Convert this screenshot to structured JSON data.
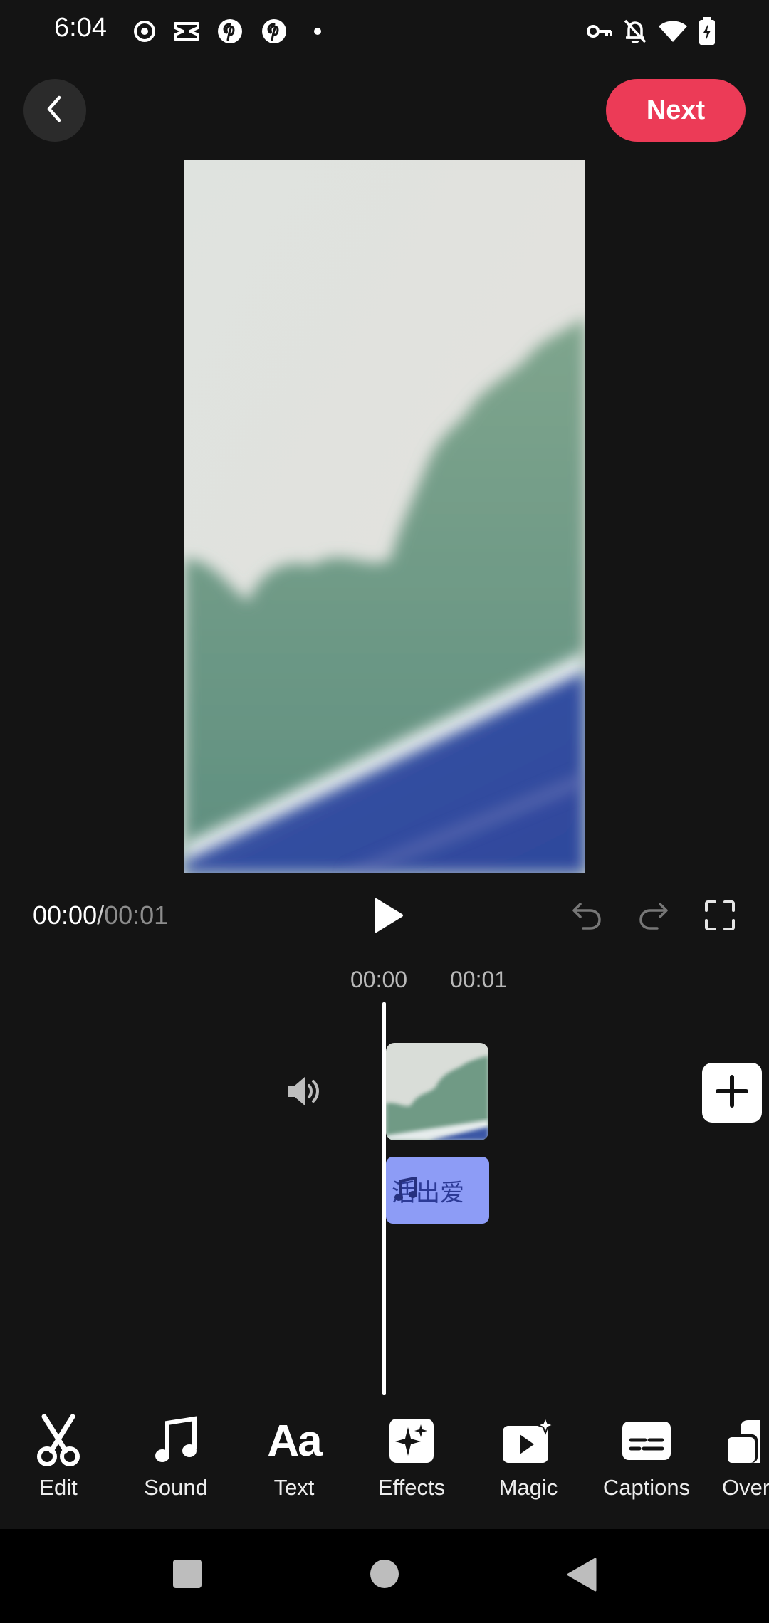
{
  "status_bar": {
    "time": "6:04",
    "left_icons": [
      "target-icon",
      "capcut-icon",
      "pinterest-icon",
      "pinterest-icon",
      "dot-icon"
    ],
    "right_icons": [
      "vpn-key-icon",
      "notifications-off-icon",
      "wifi-icon",
      "battery-charging-icon"
    ]
  },
  "header": {
    "next_label": "Next"
  },
  "playback": {
    "current_time": "00:00",
    "separator": "/",
    "total_time": "00:01"
  },
  "timeline": {
    "ticks": [
      "00:00",
      "00:01"
    ],
    "music_label": "活出爱"
  },
  "toolbar": {
    "items": [
      {
        "label": "Edit",
        "icon": "scissors-icon"
      },
      {
        "label": "Sound",
        "icon": "music-note-icon"
      },
      {
        "label": "Text",
        "icon": "text-aa-icon"
      },
      {
        "label": "Effects",
        "icon": "sparkle-icon"
      },
      {
        "label": "Magic",
        "icon": "magic-play-icon"
      },
      {
        "label": "Captions",
        "icon": "captions-icon"
      },
      {
        "label": "Overlay",
        "icon": "overlay-icon"
      }
    ]
  },
  "colors": {
    "background": "#141414",
    "accent": "#ec3b57",
    "music_clip": "#8d9cf6"
  }
}
